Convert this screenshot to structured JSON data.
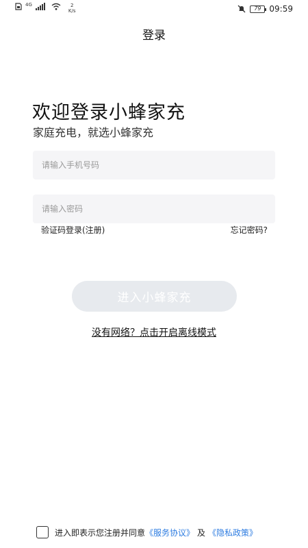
{
  "status_bar": {
    "network_label": "4G",
    "speed_value": "2",
    "speed_unit": "K/s",
    "battery": "79",
    "time": "09:59"
  },
  "header": {
    "title": "登录"
  },
  "welcome": {
    "title": "欢迎登录小蜂家充",
    "subtitle": "家庭充电，就选小蜂家充"
  },
  "form": {
    "phone_placeholder": "请输入手机号码",
    "password_placeholder": "请输入密码",
    "sms_login": "验证码登录(注册)",
    "forgot_password": "忘记密码?",
    "submit": "进入小蜂家充",
    "submit_color": "#e7eaee"
  },
  "offline": "没有网络？点击开启离线模式",
  "agreement": {
    "prefix": "进入即表示您注册并同意",
    "service": "《服务协议》",
    "and": "及",
    "privacy": "《隐私政策》",
    "link_color": "#2f7de1"
  }
}
